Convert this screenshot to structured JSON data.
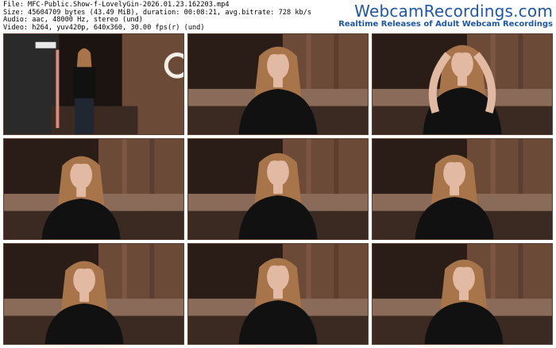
{
  "header": {
    "file_line": "File: MFC-Public.Show-f-LovelyGin-2026.01.23.162203.mp4",
    "size_line": "Size: 45604709 bytes (43.49 MiB), duration: 00:08:21, avg.bitrate: 728 kb/s",
    "audio_line": "Audio: aac, 48000 Hz, stereo (und)",
    "video_line": "Video: h264, yuv420p, 640x360, 30.00 fps(r) (und)"
  },
  "brand": {
    "name": "WebcamRecordings.com",
    "tagline": "Realtime Releases of Adult Webcam Recordings"
  },
  "thumbnails": [
    {
      "scene": "standing-far"
    },
    {
      "scene": "seated-center"
    },
    {
      "scene": "hands-on-head"
    },
    {
      "scene": "looking-down-left"
    },
    {
      "scene": "smiling-center"
    },
    {
      "scene": "looking-right"
    },
    {
      "scene": "eyes-closed-left"
    },
    {
      "scene": "smiling-center"
    },
    {
      "scene": "eyes-closed-right"
    }
  ],
  "colors": {
    "brand": "#1e56a8",
    "wall": "#6b4a38",
    "shirt": "#111111",
    "hair": "#a8744a",
    "skin": "#e2b9a2"
  }
}
